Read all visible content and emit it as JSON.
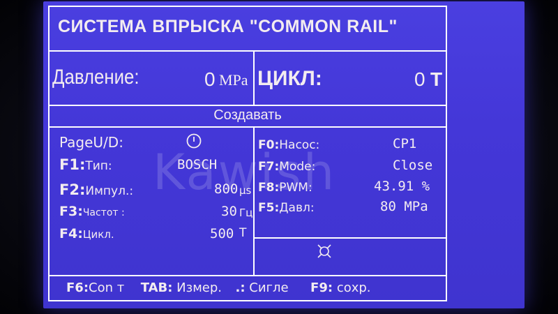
{
  "header": {
    "title": "СИСТЕМА ВПРЫСКА \"COMMON RAIL\""
  },
  "readouts": {
    "pressure_label": "Давление:",
    "pressure_value": "0",
    "pressure_unit": "MPa",
    "cycle_label": "ЦИКЛ:",
    "cycle_value": "0",
    "cycle_unit": "Т"
  },
  "mode_band": {
    "label": "Создавать"
  },
  "left_panel": {
    "page_label": "PageU/D:",
    "rows": [
      {
        "key": "F1:",
        "label": "Тип:",
        "value": "BOSCH",
        "unit": ""
      },
      {
        "key": "F2:",
        "label": "Импул.:",
        "value": "800",
        "unit": "μs"
      },
      {
        "key": "F3:",
        "label": "Частот :",
        "value": "30",
        "unit": "Гц"
      },
      {
        "key": "F4:",
        "label": "Цикл.",
        "value": "500",
        "unit": "Т"
      }
    ]
  },
  "right_panel": {
    "rows": [
      {
        "key": "F0:",
        "label": "Насос:",
        "value": "CP1"
      },
      {
        "key": "F7:",
        "label": "Mode:",
        "value": "Close"
      },
      {
        "key": "F8:",
        "label": "PWM:",
        "value": "43.91 %"
      },
      {
        "key": "F5:",
        "label": "Давл:",
        "value": "80 MPa"
      }
    ]
  },
  "footer": {
    "f6_key": "F6:",
    "f6_label": "Con т",
    "tab_key": "TAB:",
    "tab_label": "Измер.",
    "dot_key": ".:",
    "dot_label": "Сигле",
    "f9_key": "F9:",
    "f9_label": "сохр."
  },
  "watermark": {
    "text": "Kawish"
  },
  "icons": {
    "page_icon": "power-icon",
    "status_icon": "currency-sign-icon"
  },
  "colors": {
    "screen": "#4437d8",
    "text": "#f3ecf0",
    "lines": "#ffffff"
  }
}
